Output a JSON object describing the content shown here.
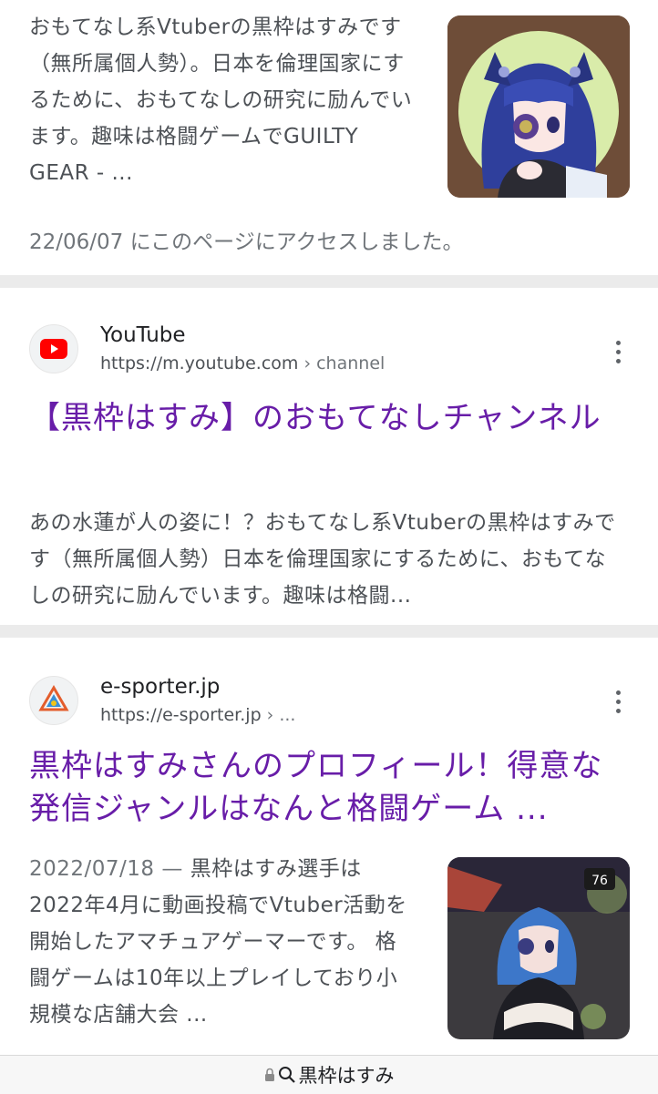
{
  "results": [
    {
      "snippet": "おもてなし系Vtuberの黒枠はすみです（無所属個人勢）。日本を倫理国家にするために、おもてなしの研究に励んでいます。趣味は格闘ゲームでGUILTY GEAR - ...",
      "visited": "22/06/07 にこのページにアクセスしました。"
    },
    {
      "site_name": "YouTube",
      "url_base": "https://m.youtube.com",
      "url_path": " › channel",
      "title": "【黒枠はすみ】のおもてなしチャンネル",
      "snippet": "あの水蓮が人の姿に！？おもてなし系Vtuberの黒枠はすみです（無所属個人勢）日本を倫理国家にするために、おもてなしの研究に励んでいます。趣味は格闘..."
    },
    {
      "site_name": "e-sporter.jp",
      "url_base": "https://e-sporter.jp",
      "url_path": " › ...",
      "title": "黒枠はすみさんのプロフィール！得意な発信ジャンルはなんと格闘ゲーム ...",
      "date": "2022/07/18",
      "date_sep": " — ",
      "snippet": "黒枠はすみ選手は2022年4月に動画投稿でVtuber活動を開始したアマチュアゲーマーです。 格闘ゲームは10年以上プレイしており小規模な店舗大会 ...",
      "thumb_badge": "76"
    }
  ],
  "bottom_bar": {
    "query": "黒枠はすみ"
  },
  "colors": {
    "title_visited": "#681da8",
    "snippet": "#4d5156",
    "youtube_red": "#ff0000",
    "separator": "#ebebeb"
  }
}
